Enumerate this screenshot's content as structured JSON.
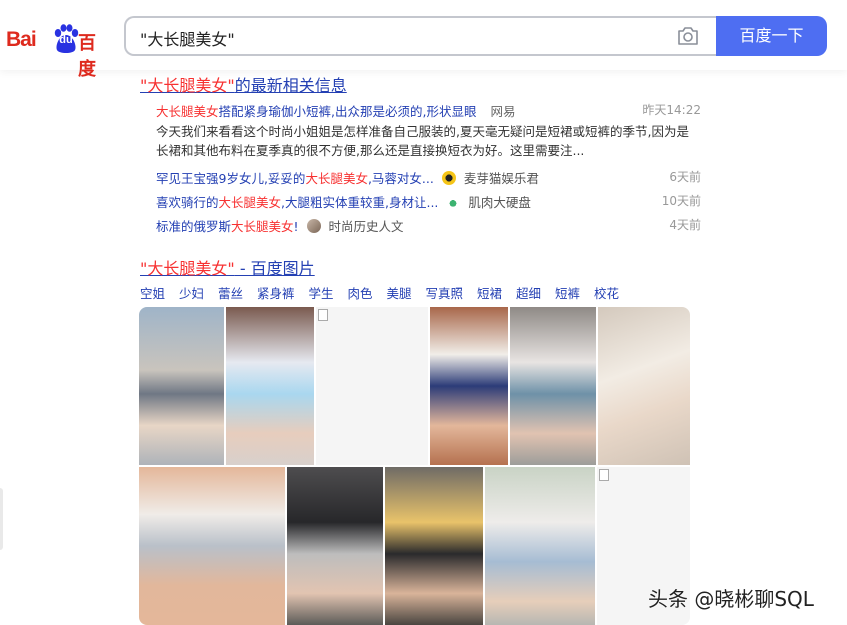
{
  "header": {
    "logo_bai": "Bai",
    "logo_du": "du",
    "logo_cn": "百度",
    "search_value": "\"大长腿美女\"",
    "search_button": "百度一下"
  },
  "news": {
    "title_hl": "\"大长腿美女\"",
    "title_rest": "的最新相关信息",
    "main": {
      "title_hl": "大长腿美女",
      "title_rest": "搭配紧身瑜伽小短裤,出众那是必须的,形状显眼",
      "source": "网易",
      "time": "昨天14:22",
      "desc": "今天我们来看看这个时尚小姐姐是怎样准备自己服装的,夏天毫无疑问是短裙或短裤的季节,因为是长裙和其他布料在夏季真的很不方便,那么还是直接换短衣为好。这里需要注..."
    },
    "items": [
      {
        "title_a": "罕见王宝强9岁女儿,妥妥的",
        "title_hl": "大长腿美女",
        "title_b": ",马蓉对女...",
        "source": "麦芽猫娱乐君",
        "time": "6天前"
      },
      {
        "title_a": "喜欢骑行的",
        "title_hl": "大长腿美女",
        "title_b": ",大腿粗实体重较重,身材让...",
        "source": "肌肉大硬盘",
        "time": "10天前"
      },
      {
        "title_a": "标准的俄罗斯",
        "title_hl": "大长腿美女",
        "title_b": "!",
        "source": "时尚历史人文",
        "time": "4天前"
      }
    ]
  },
  "images": {
    "title_hl": "\"大长腿美女\"",
    "title_rest": " - 百度图片",
    "tags": [
      "空姐",
      "少妇",
      "蕾丝",
      "紧身裤",
      "学生",
      "肉色",
      "美腿",
      "写真照",
      "短裙",
      "超细",
      "短裤",
      "校花"
    ]
  },
  "watermark": "头条 @晓彬聊SQL",
  "colors": {
    "brand_red": "#de2a1e",
    "brand_blue": "#2932e1",
    "link": "#2440b3",
    "highlight": "#f73131",
    "button": "#4e6ef2"
  }
}
